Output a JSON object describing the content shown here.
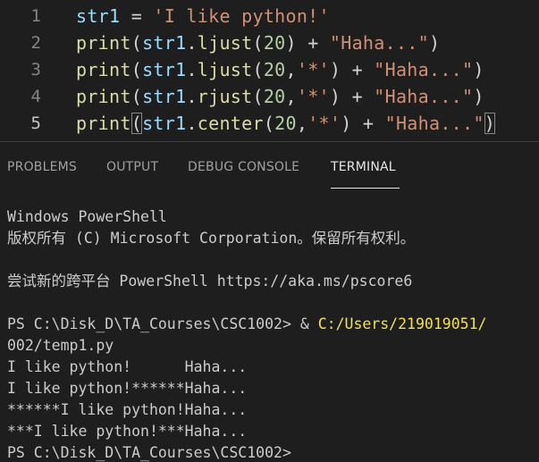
{
  "editor": {
    "lines": [
      {
        "number": "1",
        "tokens": [
          {
            "t": "str1",
            "k": "var"
          },
          {
            "t": " = ",
            "k": "op"
          },
          {
            "t": "'I like python!'",
            "k": "str"
          }
        ]
      },
      {
        "number": "2",
        "tokens": [
          {
            "t": "print",
            "k": "fn"
          },
          {
            "t": "(",
            "k": "op"
          },
          {
            "t": "str1",
            "k": "var"
          },
          {
            "t": ".",
            "k": "op"
          },
          {
            "t": "ljust",
            "k": "fn"
          },
          {
            "t": "(",
            "k": "op"
          },
          {
            "t": "20",
            "k": "num"
          },
          {
            "t": ") + ",
            "k": "op"
          },
          {
            "t": "\"Haha...\"",
            "k": "str"
          },
          {
            "t": ")",
            "k": "op"
          }
        ]
      },
      {
        "number": "3",
        "tokens": [
          {
            "t": "print",
            "k": "fn"
          },
          {
            "t": "(",
            "k": "op"
          },
          {
            "t": "str1",
            "k": "var"
          },
          {
            "t": ".",
            "k": "op"
          },
          {
            "t": "ljust",
            "k": "fn"
          },
          {
            "t": "(",
            "k": "op"
          },
          {
            "t": "20",
            "k": "num"
          },
          {
            "t": ",",
            "k": "op"
          },
          {
            "t": "'*'",
            "k": "str"
          },
          {
            "t": ") + ",
            "k": "op"
          },
          {
            "t": "\"Haha...\"",
            "k": "str"
          },
          {
            "t": ")",
            "k": "op"
          }
        ]
      },
      {
        "number": "4",
        "tokens": [
          {
            "t": "print",
            "k": "fn"
          },
          {
            "t": "(",
            "k": "op"
          },
          {
            "t": "str1",
            "k": "var"
          },
          {
            "t": ".",
            "k": "op"
          },
          {
            "t": "rjust",
            "k": "fn"
          },
          {
            "t": "(",
            "k": "op"
          },
          {
            "t": "20",
            "k": "num"
          },
          {
            "t": ",",
            "k": "op"
          },
          {
            "t": "'*'",
            "k": "str"
          },
          {
            "t": ") + ",
            "k": "op"
          },
          {
            "t": "\"Haha...\"",
            "k": "str"
          },
          {
            "t": ")",
            "k": "op"
          }
        ]
      },
      {
        "number": "5",
        "current": true,
        "tokens": [
          {
            "t": "print",
            "k": "fn"
          },
          {
            "t": "(",
            "k": "op",
            "match": true
          },
          {
            "t": "str1",
            "k": "var"
          },
          {
            "t": ".",
            "k": "op"
          },
          {
            "t": "center",
            "k": "fn"
          },
          {
            "t": "(",
            "k": "op"
          },
          {
            "t": "20",
            "k": "num"
          },
          {
            "t": ",",
            "k": "op"
          },
          {
            "t": "'*'",
            "k": "str"
          },
          {
            "t": ") + ",
            "k": "op"
          },
          {
            "t": "\"Haha...\"",
            "k": "str"
          },
          {
            "t": ")",
            "k": "op",
            "match": true
          }
        ]
      }
    ]
  },
  "panel": {
    "tabs": [
      {
        "label": "PROBLEMS",
        "active": false
      },
      {
        "label": "OUTPUT",
        "active": false
      },
      {
        "label": "DEBUG CONSOLE",
        "active": false
      },
      {
        "label": "TERMINAL",
        "active": true
      }
    ]
  },
  "terminal": {
    "lines": [
      {
        "text": "Windows PowerShell"
      },
      {
        "text": "版权所有 (C) Microsoft Corporation。保留所有权利。"
      },
      {
        "text": ""
      },
      {
        "text": "尝试新的跨平台 PowerShell https://aka.ms/pscore6"
      },
      {
        "text": ""
      },
      {
        "prompt": "PS C:\\Disk_D\\TA_Courses\\CSC1002> ",
        "op": "& ",
        "path": "C:/Users/219019051/"
      },
      {
        "text": "002/temp1.py"
      },
      {
        "text": "I like python!      Haha..."
      },
      {
        "text": "I like python!******Haha..."
      },
      {
        "text": "******I like python!Haha..."
      },
      {
        "text": "***I like python!***Haha..."
      },
      {
        "text": "PS C:\\Disk_D\\TA_Courses\\CSC1002> "
      }
    ]
  },
  "colors": {
    "background": "#1e1e1e",
    "keyword_fn": "#dcdcaa",
    "variable": "#9cdcfe",
    "string": "#ce9178",
    "number": "#b5cea8",
    "terminal_path": "#f1e05a"
  }
}
